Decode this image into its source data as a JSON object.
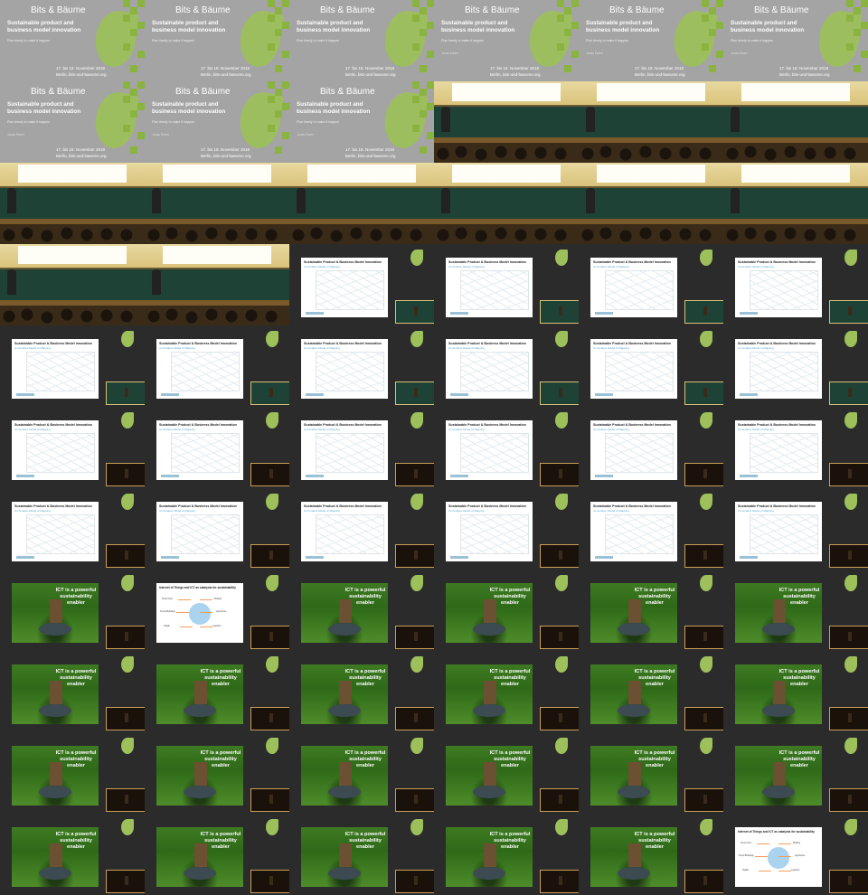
{
  "title_slide": {
    "series": "Bits & Bäume",
    "heading": "Sustainable product and business model innovation",
    "subheading": "Plan timely to make it happen",
    "author": "Jonas Ewert",
    "date": "17. bis 18. November 2018",
    "website": "Berlin, bits-und-baeume.org"
  },
  "model_slide": {
    "title": "Sustainable Product & Business Model Innovation",
    "subtitle": "An Iterative Model of Mapping"
  },
  "grass_slide": {
    "text": "ICT is a powerful sustainability enabler"
  },
  "iot_slide": {
    "title": "Internet of Things and ICT as catalysts for sustainability",
    "labels": [
      "Smart Grid",
      "Mobility",
      "Smart Buildings",
      "Agriculture",
      "Health",
      "Logistics"
    ]
  },
  "tiles": [
    "title",
    "title",
    "title",
    "title",
    "title",
    "title",
    "title",
    "title",
    "title",
    "room",
    "room",
    "room",
    "room",
    "room",
    "room",
    "room",
    "room",
    "room",
    "room",
    "room",
    "slide",
    "slide",
    "slide",
    "slide",
    "slide",
    "slide",
    "slide",
    "slide",
    "slide",
    "slide",
    "slide-dark",
    "slide-dark",
    "slide-dark",
    "slide-dark",
    "slide-dark",
    "slide-dark",
    "slide-dark",
    "slide-dark",
    "slide-dark",
    "slide-dark",
    "slide-dark",
    "slide-dark",
    "grass",
    "iot",
    "grass",
    "grass",
    "grass",
    "grass",
    "grass",
    "grass",
    "grass",
    "grass",
    "grass",
    "grass",
    "grass",
    "grass",
    "grass",
    "grass",
    "grass",
    "grass",
    "grass",
    "grass",
    "grass",
    "grass",
    "grass",
    "iot"
  ]
}
